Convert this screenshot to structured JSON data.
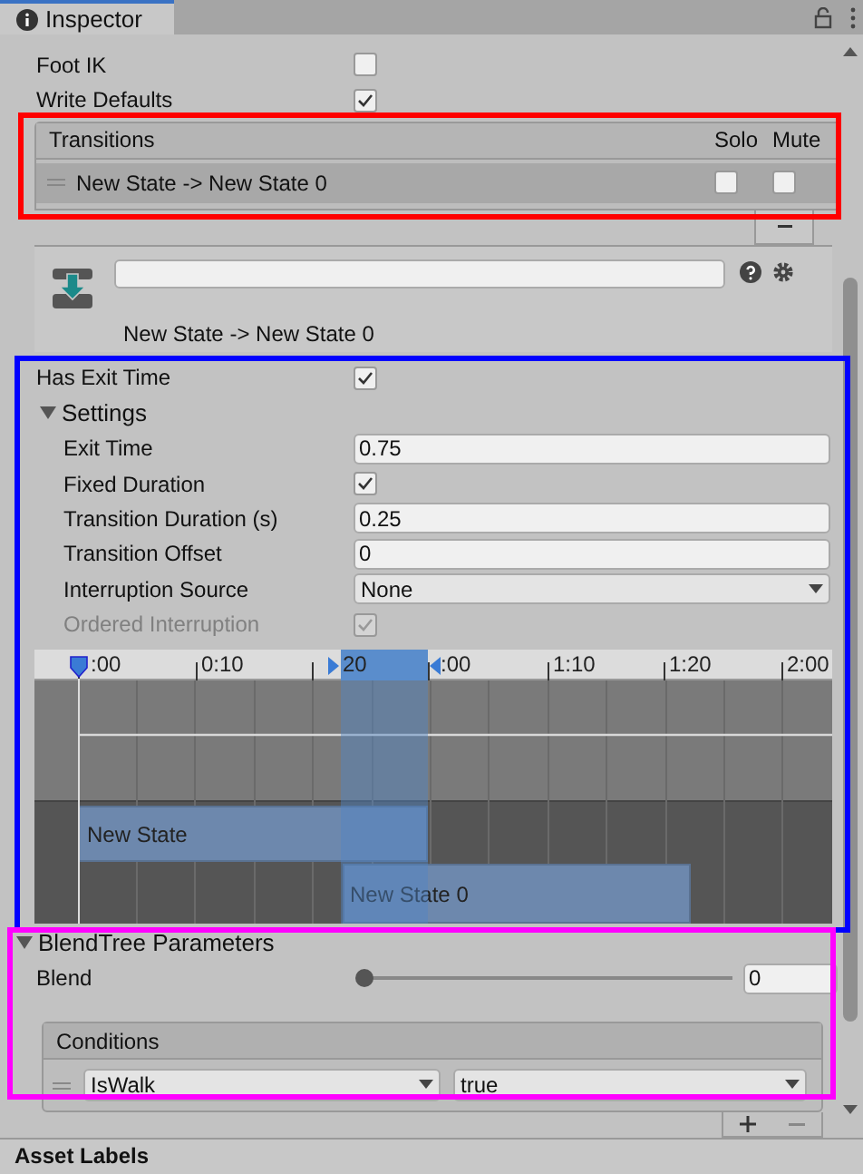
{
  "tab": {
    "title": "Inspector",
    "selected": true
  },
  "state_fields": [
    {
      "label": "Foot IK",
      "checked": false
    },
    {
      "label": "Write Defaults",
      "checked": true
    }
  ],
  "transitions": {
    "header": "Transitions",
    "solo_label": "Solo",
    "mute_label": "Mute",
    "rows": [
      {
        "name": "New State -> New State 0",
        "solo": false,
        "mute": false,
        "selected": true
      }
    ]
  },
  "transition": {
    "title": "New State -> New State 0"
  },
  "has_exit_time": {
    "label": "Has Exit Time",
    "checked": true
  },
  "settings": {
    "label": "Settings",
    "expanded": true,
    "fields": [
      {
        "kind": "number",
        "label": "Exit Time",
        "value": "0.75",
        "disabled": false
      },
      {
        "kind": "checkbox",
        "label": "Fixed Duration",
        "checked": true,
        "disabled": false
      },
      {
        "kind": "number",
        "label": "Transition Duration (s)",
        "value": "0.25",
        "disabled": false
      },
      {
        "kind": "number",
        "label": "Transition Offset",
        "value": "0",
        "disabled": false
      },
      {
        "kind": "dropdown",
        "label": "Interruption Source",
        "value": "None",
        "disabled": false
      },
      {
        "kind": "checkbox",
        "label": "Ordered Interruption",
        "checked": true,
        "disabled": true
      }
    ]
  },
  "timeline": {
    "ticks": [
      ":00",
      "0:10",
      "20",
      ":00",
      "1:10",
      "1:20",
      "2:00"
    ],
    "clips": [
      {
        "name": "New State"
      },
      {
        "name": "New State 0"
      }
    ]
  },
  "blend_tree": {
    "label": "BlendTree Parameters",
    "expanded": true,
    "parameters": [
      {
        "label": "Blend",
        "level": 0,
        "value": "0"
      }
    ]
  },
  "conditions": {
    "header": "Conditions",
    "rows": [
      {
        "parameter": "IsWalk",
        "value": "true"
      }
    ]
  },
  "asset_labels": "Asset Labels",
  "annotations": [
    {
      "color": "#ff0000"
    },
    {
      "color": "#0000ff"
    },
    {
      "color": "#ff00ff"
    }
  ]
}
